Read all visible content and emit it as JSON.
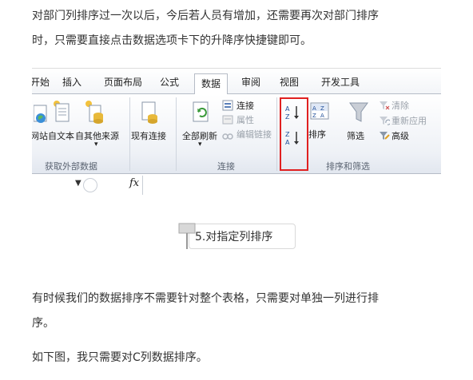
{
  "intro": {
    "line1": "对部门列排序过一次以后，今后若人员有增加，还需要再次对部门排序",
    "line2": "时，只需要直接点击数据选项卡下的升降序快捷键即可。"
  },
  "ribbon": {
    "tabs": [
      "开始",
      "插入",
      "页面布局",
      "公式",
      "数据",
      "审阅",
      "视图",
      "开发工具"
    ],
    "active_tab": "数据",
    "external_buttons": [
      "网站",
      "自文本",
      "自其他来源",
      "现有连接"
    ],
    "refresh_all": "全部刷新",
    "connection_items": [
      "连接",
      "属性",
      "编辑链接"
    ],
    "sort_label": "排序",
    "filter_label": "筛选",
    "filter_items": [
      "清除",
      "重新应用",
      "高级"
    ],
    "group_labels": [
      "获取外部数据",
      "连接",
      "排序和筛选"
    ],
    "fx": "fx",
    "accent_color": "#e02020"
  },
  "caption": {
    "text": "5.对指定列排序"
  },
  "body": {
    "para1_line1": "有时候我们的数据排序不需要针对整个表格，只需要对单独一列进行排",
    "para1_line2": "序。",
    "para2": "如下图，我只需要对C列数据排序。"
  }
}
